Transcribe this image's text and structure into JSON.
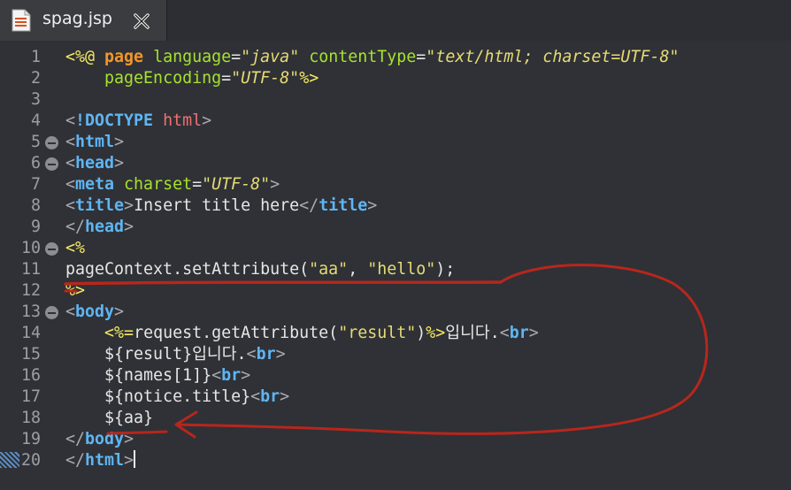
{
  "tab": {
    "filename": "spag.jsp"
  },
  "lines": [
    {
      "n": "1",
      "fold": false,
      "tokens": [
        {
          "c": "t-dir",
          "t": "<%@ "
        },
        {
          "c": "t-kw",
          "t": "page "
        },
        {
          "c": "t-attr",
          "t": "language"
        },
        {
          "c": "t-txt",
          "t": "="
        },
        {
          "c": "t-str",
          "t": "\""
        },
        {
          "c": "t-val",
          "t": "java"
        },
        {
          "c": "t-str",
          "t": "\" "
        },
        {
          "c": "t-attr",
          "t": "contentType"
        },
        {
          "c": "t-txt",
          "t": "="
        },
        {
          "c": "t-str",
          "t": "\""
        },
        {
          "c": "t-val",
          "t": "text/html; charset=UTF-8"
        },
        {
          "c": "t-str",
          "t": "\""
        }
      ]
    },
    {
      "n": "2",
      "fold": false,
      "tokens": [
        {
          "c": "t-txt",
          "t": "    "
        },
        {
          "c": "t-attr",
          "t": "pageEncoding"
        },
        {
          "c": "t-txt",
          "t": "="
        },
        {
          "c": "t-str",
          "t": "\""
        },
        {
          "c": "t-val",
          "t": "UTF-8"
        },
        {
          "c": "t-str",
          "t": "\""
        },
        {
          "c": "t-dir",
          "t": "%>"
        }
      ]
    },
    {
      "n": "3",
      "fold": false,
      "tokens": []
    },
    {
      "n": "4",
      "fold": false,
      "tokens": [
        {
          "c": "t-brk",
          "t": "<"
        },
        {
          "c": "t-doc",
          "t": "!DOCTYPE "
        },
        {
          "c": "t-doc2",
          "t": "html"
        },
        {
          "c": "t-brk",
          "t": ">"
        }
      ]
    },
    {
      "n": "5",
      "fold": true,
      "tokens": [
        {
          "c": "t-brk",
          "t": "<"
        },
        {
          "c": "t-tag",
          "t": "html"
        },
        {
          "c": "t-brk",
          "t": ">"
        }
      ]
    },
    {
      "n": "6",
      "fold": true,
      "tokens": [
        {
          "c": "t-brk",
          "t": "<"
        },
        {
          "c": "t-tag",
          "t": "head"
        },
        {
          "c": "t-brk",
          "t": ">"
        }
      ]
    },
    {
      "n": "7",
      "fold": false,
      "tokens": [
        {
          "c": "t-brk",
          "t": "<"
        },
        {
          "c": "t-tag",
          "t": "meta "
        },
        {
          "c": "t-attr",
          "t": "charset"
        },
        {
          "c": "t-txt",
          "t": "="
        },
        {
          "c": "t-str",
          "t": "\""
        },
        {
          "c": "t-val",
          "t": "UTF-8"
        },
        {
          "c": "t-str",
          "t": "\""
        },
        {
          "c": "t-brk",
          "t": ">"
        }
      ]
    },
    {
      "n": "8",
      "fold": false,
      "tokens": [
        {
          "c": "t-brk",
          "t": "<"
        },
        {
          "c": "t-tag",
          "t": "title"
        },
        {
          "c": "t-brk",
          "t": ">"
        },
        {
          "c": "t-txt",
          "t": "Insert title here"
        },
        {
          "c": "t-brk",
          "t": "</"
        },
        {
          "c": "t-tag",
          "t": "title"
        },
        {
          "c": "t-brk",
          "t": ">"
        }
      ]
    },
    {
      "n": "9",
      "fold": false,
      "tokens": [
        {
          "c": "t-brk",
          "t": "</"
        },
        {
          "c": "t-tag",
          "t": "head"
        },
        {
          "c": "t-brk",
          "t": ">"
        }
      ]
    },
    {
      "n": "10",
      "fold": true,
      "tokens": [
        {
          "c": "t-dir",
          "t": "<%"
        }
      ]
    },
    {
      "n": "11",
      "fold": false,
      "tokens": [
        {
          "c": "t-txt",
          "t": "pageContext.setAttribute("
        },
        {
          "c": "t-str",
          "t": "\"aa\""
        },
        {
          "c": "t-txt",
          "t": ", "
        },
        {
          "c": "t-str",
          "t": "\"hello\""
        },
        {
          "c": "t-txt",
          "t": ");"
        }
      ]
    },
    {
      "n": "12",
      "fold": false,
      "tokens": [
        {
          "c": "t-dir",
          "t": "%>"
        }
      ]
    },
    {
      "n": "13",
      "fold": true,
      "tokens": [
        {
          "c": "t-brk",
          "t": "<"
        },
        {
          "c": "t-tag",
          "t": "body"
        },
        {
          "c": "t-brk",
          "t": ">"
        }
      ]
    },
    {
      "n": "14",
      "fold": false,
      "tokens": [
        {
          "c": "t-txt",
          "t": "    "
        },
        {
          "c": "t-dir",
          "t": "<%="
        },
        {
          "c": "t-txt",
          "t": "request.getAttribute("
        },
        {
          "c": "t-str",
          "t": "\"result\""
        },
        {
          "c": "t-txt",
          "t": ")"
        },
        {
          "c": "t-dir",
          "t": "%>"
        },
        {
          "c": "t-txt",
          "t": "입니다."
        },
        {
          "c": "t-brk",
          "t": "<"
        },
        {
          "c": "t-tag",
          "t": "br"
        },
        {
          "c": "t-brk",
          "t": ">"
        }
      ]
    },
    {
      "n": "15",
      "fold": false,
      "tokens": [
        {
          "c": "t-txt",
          "t": "    ${result}입니다."
        },
        {
          "c": "t-brk",
          "t": "<"
        },
        {
          "c": "t-tag",
          "t": "br"
        },
        {
          "c": "t-brk",
          "t": ">"
        }
      ]
    },
    {
      "n": "16",
      "fold": false,
      "tokens": [
        {
          "c": "t-txt",
          "t": "    ${names[1]}"
        },
        {
          "c": "t-brk",
          "t": "<"
        },
        {
          "c": "t-tag",
          "t": "br"
        },
        {
          "c": "t-brk",
          "t": ">"
        }
      ]
    },
    {
      "n": "17",
      "fold": false,
      "tokens": [
        {
          "c": "t-txt",
          "t": "    ${notice.title}"
        },
        {
          "c": "t-brk",
          "t": "<"
        },
        {
          "c": "t-tag",
          "t": "br"
        },
        {
          "c": "t-brk",
          "t": ">"
        }
      ]
    },
    {
      "n": "18",
      "fold": false,
      "tokens": [
        {
          "c": "t-txt",
          "t": "    ${aa}"
        }
      ]
    },
    {
      "n": "19",
      "fold": false,
      "tokens": [
        {
          "c": "t-brk",
          "t": "</"
        },
        {
          "c": "t-tag",
          "t": "body"
        },
        {
          "c": "t-brk",
          "t": ">"
        }
      ]
    },
    {
      "n": "20",
      "fold": false,
      "cursor": true,
      "tokens": [
        {
          "c": "t-brk",
          "t": "</"
        },
        {
          "c": "t-tag",
          "t": "html"
        },
        {
          "c": "t-brk",
          "t": ">"
        }
      ]
    }
  ],
  "colors": {
    "background": "#2f3136",
    "annotation": "#b8261c"
  }
}
